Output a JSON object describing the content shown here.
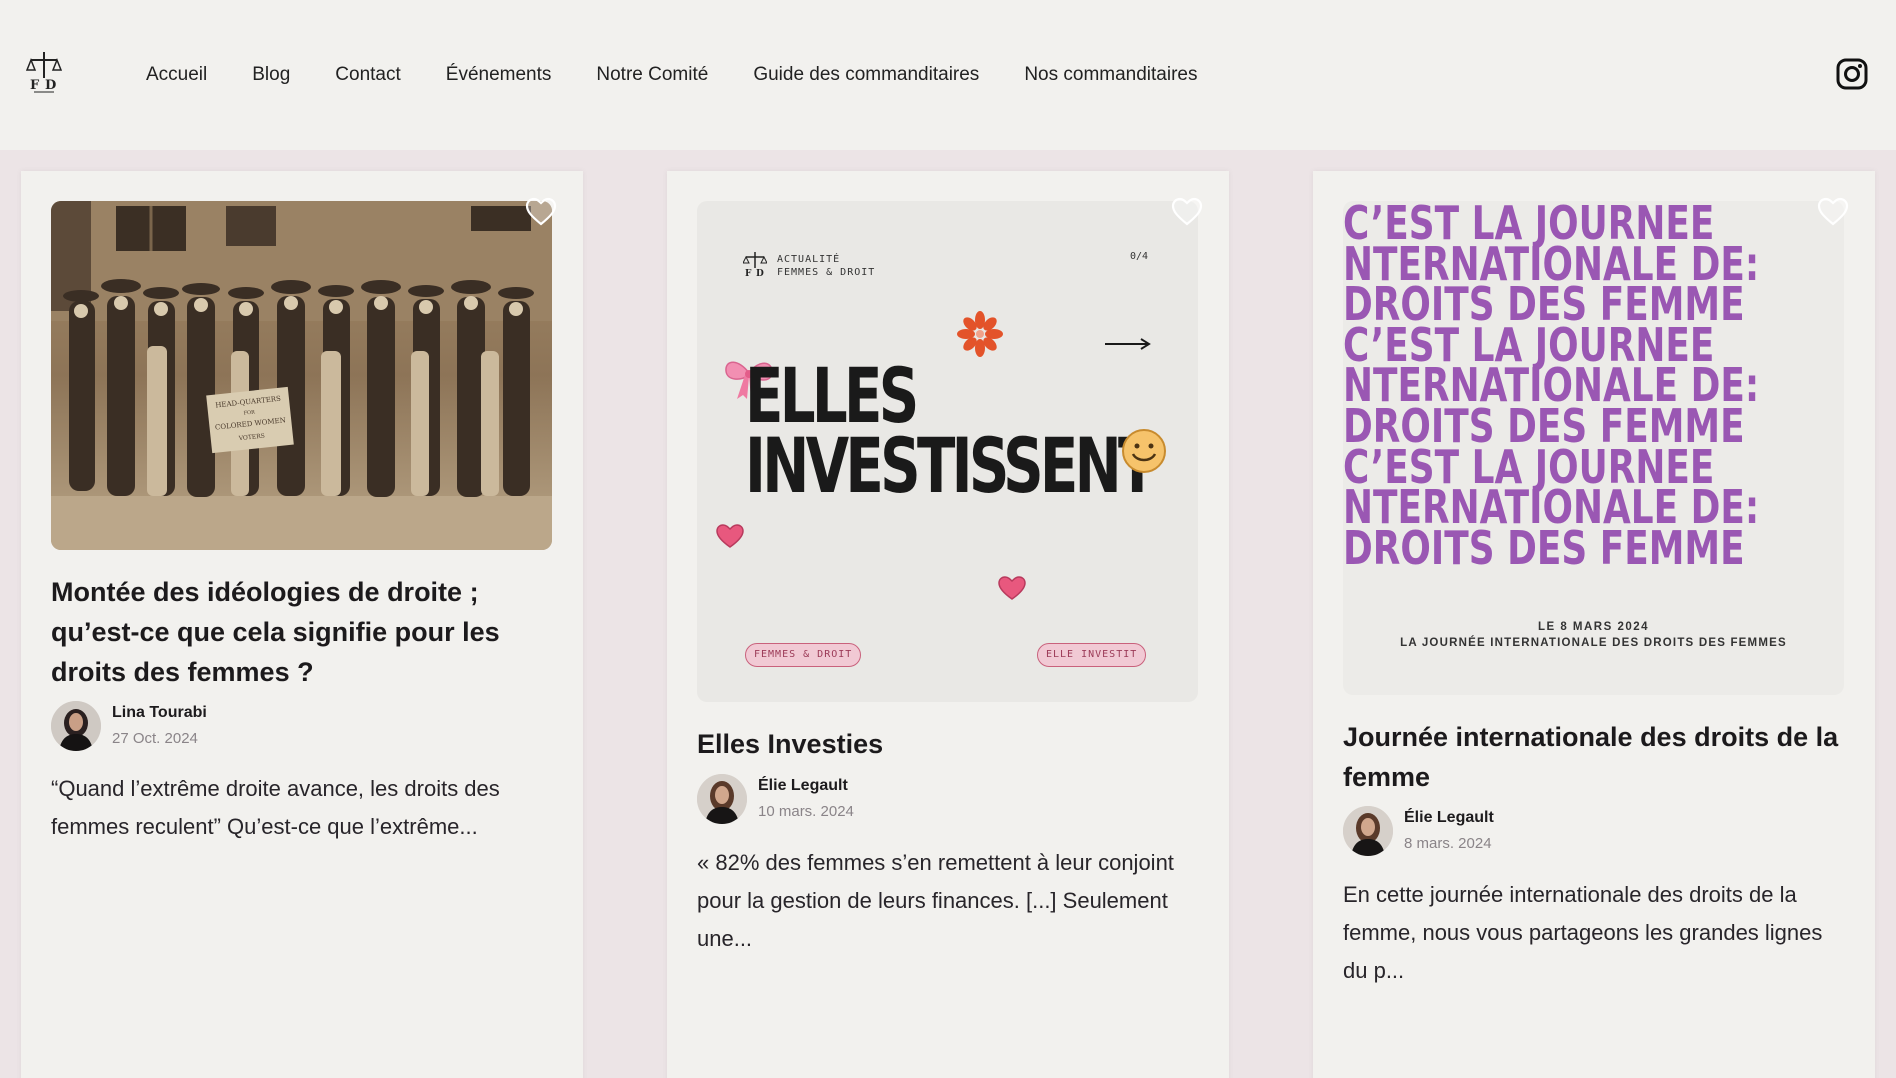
{
  "nav": {
    "logo_alt": "FD",
    "items": [
      {
        "label": "Accueil"
      },
      {
        "label": "Blog"
      },
      {
        "label": "Contact"
      },
      {
        "label": "Événements"
      },
      {
        "label": "Notre Comité"
      },
      {
        "label": "Guide des commanditaires"
      },
      {
        "label": "Nos commanditaires"
      }
    ],
    "instagram_icon": "instagram-icon"
  },
  "colors": {
    "page_background": "#ece4e6",
    "card_background": "#f2f1ee",
    "accent_purple": "#9a57b3",
    "accent_pink": "#e8587e"
  },
  "posts": [
    {
      "title": "Montée des idéologies de droite ; qu’est-ce que cela signifie pour les droits des femmes ?",
      "author": "Lina Tourabi",
      "date": "27 Oct. 2024",
      "excerpt": "“Quand l’extrême droite avance, les droits des femmes reculent” Qu’est-ce que l’extrême...",
      "image": {
        "sign_lines": [
          "HEAD-QUARTERS",
          "FOR",
          "COLORED WOMEN",
          "VOTERS"
        ]
      }
    },
    {
      "title": "Elles Investies",
      "author": "Élie Legault",
      "date": "10 mars. 2024",
      "excerpt": "« 82% des femmes s’en remettent à leur conjoint pour la gestion de leurs finances. [...] Seulement une...",
      "image": {
        "brand_line1": "ACTUALITÉ",
        "brand_line2": "FEMMES & DROIT",
        "counter": "0/4",
        "headline_line1": "ELLES",
        "headline_line2": "INVESTISSENT",
        "pill_left": "FEMMES & DROIT",
        "pill_right": "ELLE INVESTIT"
      }
    },
    {
      "title": "Journée internationale des droits de la femme",
      "author": "Élie Legault",
      "date": "8 mars. 2024",
      "excerpt": "En cette journée internationale des droits de la femme, nous vous partageons les grandes lignes du p...",
      "image": {
        "lines": [
          "C’EST LA JOURNÉE",
          "NTERNATIONALE DE:",
          "DROITS DES FEMME",
          "C’EST LA JOURNEE",
          "NTERNATIONALE DE:",
          "DROITS DES FEMME",
          "C’EST LA JOURNEE",
          "NTERNATIONALE DE:",
          "DROITS DES FEMME"
        ],
        "date_line": "LE 8 MARS 2024",
        "caption_line": "LA JOURNÉE INTERNATIONALE DES DROITS DES FEMMES"
      }
    }
  ]
}
